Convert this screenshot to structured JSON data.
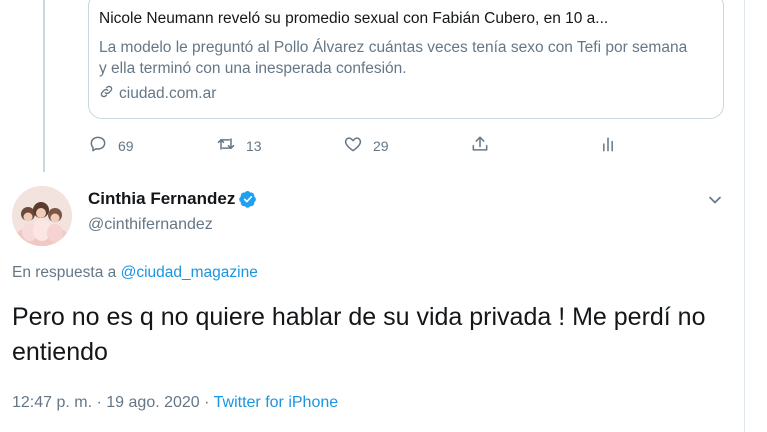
{
  "card": {
    "title": "Nicole Neumann reveló su promedio sexual con Fabián Cubero, en 10 a...",
    "description": "La modelo le preguntó al Pollo Álvarez cuántas veces tenía sexo con Tefi por semana y ella terminó con una inesperada confesión.",
    "domain": "ciudad.com.ar",
    "domain_icon": "link-icon"
  },
  "actions": {
    "reply_count": "69",
    "retweet_count": "13",
    "like_count": "29"
  },
  "tweet": {
    "display_name": "Cinthia Fernandez",
    "handle": "@cinthifernandez",
    "verified": true,
    "reply_prefix": "En respuesta a",
    "reply_to": "@ciudad_magazine",
    "text": "Pero no es q no quiere hablar de su vida privada ! Me perdí no entiendo",
    "time": "12:47 p. m.",
    "separator": "·",
    "date": "19 ago. 2020",
    "source": "Twitter for iPhone"
  },
  "colors": {
    "accent": "#1b95e0",
    "muted": "#657786",
    "text": "#14171a",
    "border": "#ccd6dd"
  }
}
